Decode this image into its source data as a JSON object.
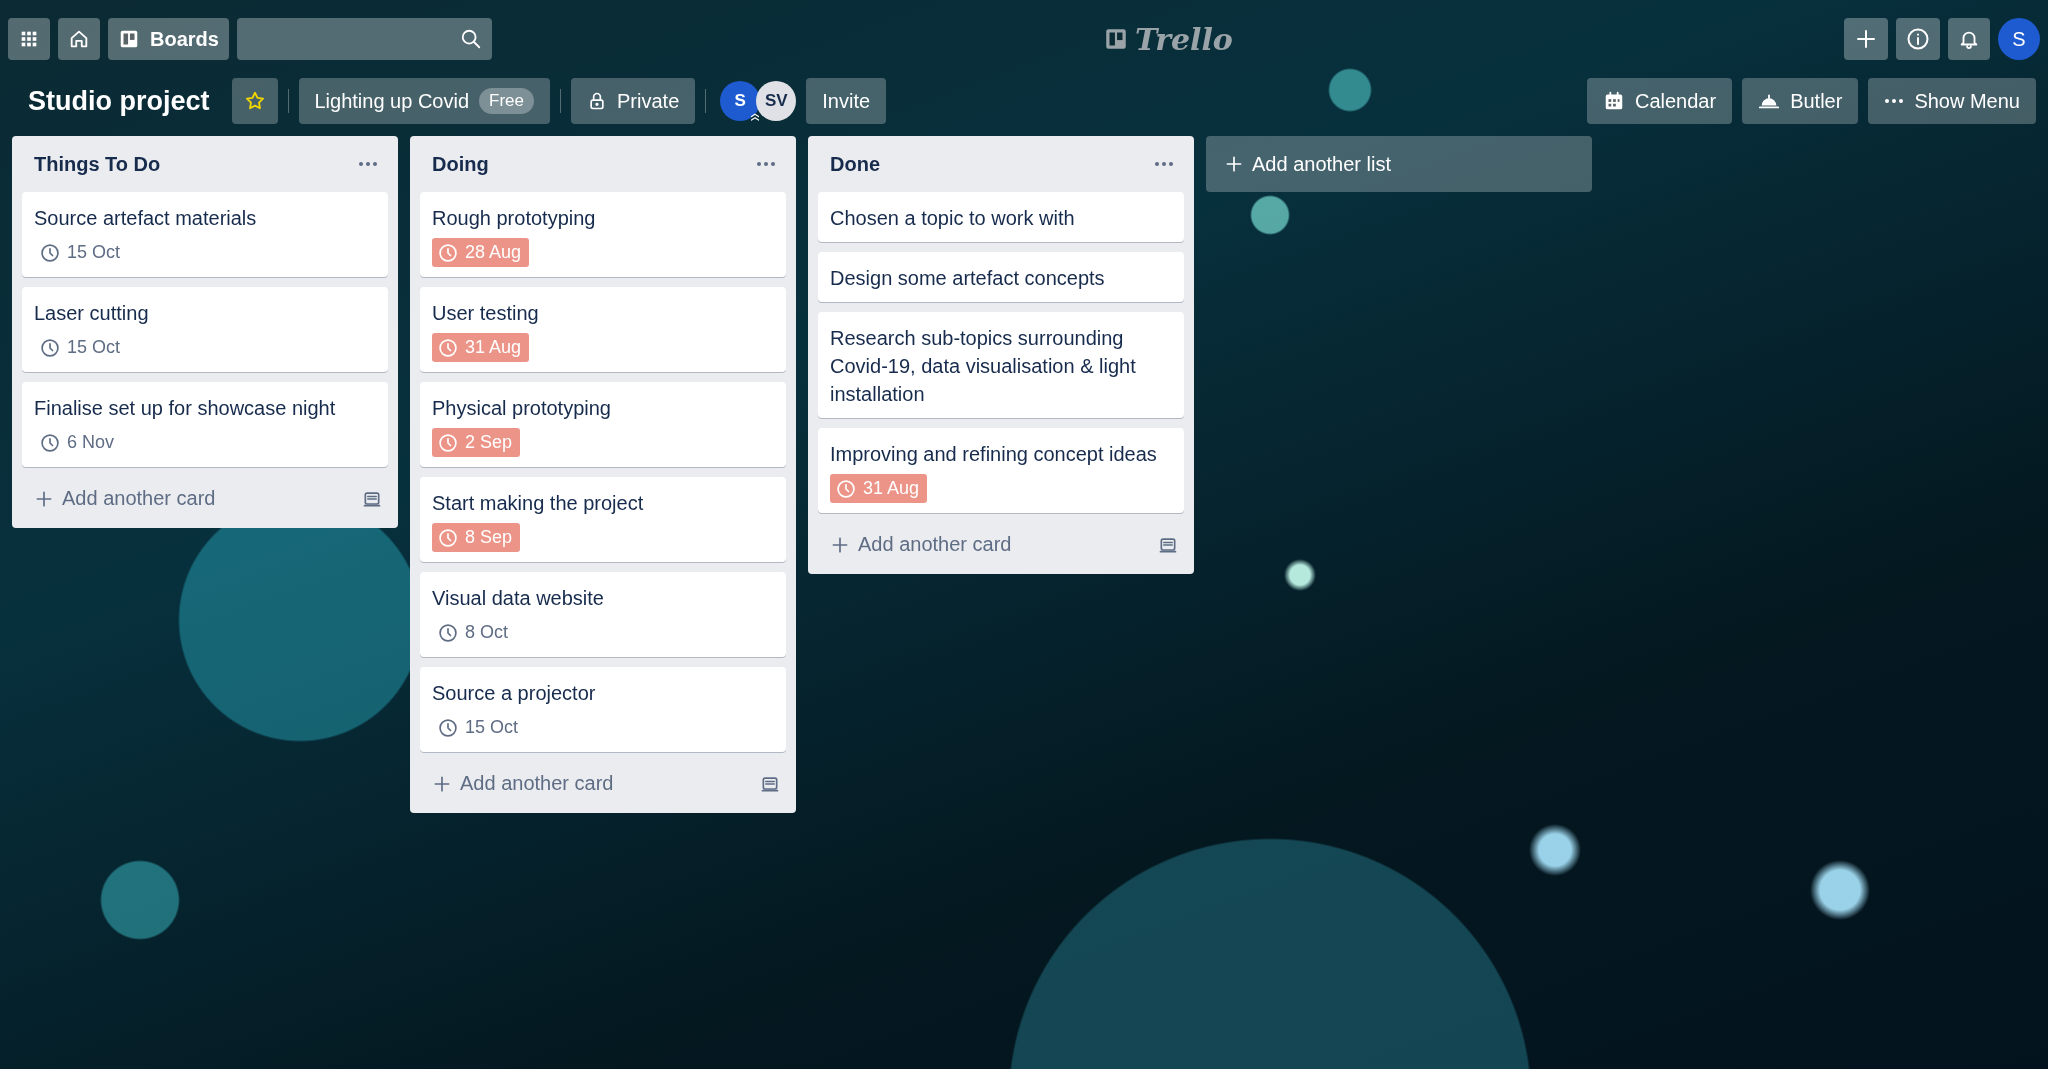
{
  "header": {
    "boards_label": "Boards",
    "logo": "Trello",
    "avatar": "S"
  },
  "board": {
    "title": "Studio project",
    "starred": true,
    "workspace": "Lighting up Covid",
    "plan": "Free",
    "visibility": "Private",
    "members": [
      {
        "initials": "S",
        "color": "#1e5bd0",
        "admin": true
      },
      {
        "initials": "SV",
        "color": "#dfe1e6",
        "admin": false
      }
    ],
    "invite": "Invite",
    "actions": [
      {
        "kind": "calendar",
        "label": "Calendar"
      },
      {
        "kind": "butler",
        "label": "Butler"
      },
      {
        "kind": "menu",
        "label": "Show Menu"
      }
    ]
  },
  "lists": [
    {
      "title": "Things To Do",
      "add_card": "Add another card",
      "cards": [
        {
          "title": "Source artefact materials",
          "due": "15 Oct",
          "overdue": false
        },
        {
          "title": "Laser cutting",
          "due": "15 Oct",
          "overdue": false
        },
        {
          "title": "Finalise set up for showcase night",
          "due": "6 Nov",
          "overdue": false
        }
      ]
    },
    {
      "title": "Doing",
      "add_card": "Add another card",
      "cards": [
        {
          "title": "Rough prototyping",
          "due": "28 Aug",
          "overdue": true
        },
        {
          "title": "User testing",
          "due": "31 Aug",
          "overdue": true
        },
        {
          "title": "Physical prototyping",
          "due": "2 Sep",
          "overdue": true
        },
        {
          "title": "Start making the project",
          "due": "8 Sep",
          "overdue": true
        },
        {
          "title": "Visual data website",
          "due": "8 Oct",
          "overdue": false
        },
        {
          "title": "Source a projector",
          "due": "15 Oct",
          "overdue": false
        }
      ]
    },
    {
      "title": "Done",
      "add_card": "Add another card",
      "cards": [
        {
          "title": "Chosen a topic to work with"
        },
        {
          "title": "Design some artefact concepts"
        },
        {
          "title": "Research sub-topics surrounding Covid-19, data visualisation & light installation"
        },
        {
          "title": "Improving and refining concept ideas",
          "due": "31 Aug",
          "overdue": true
        }
      ]
    }
  ],
  "add_list": "Add another list"
}
